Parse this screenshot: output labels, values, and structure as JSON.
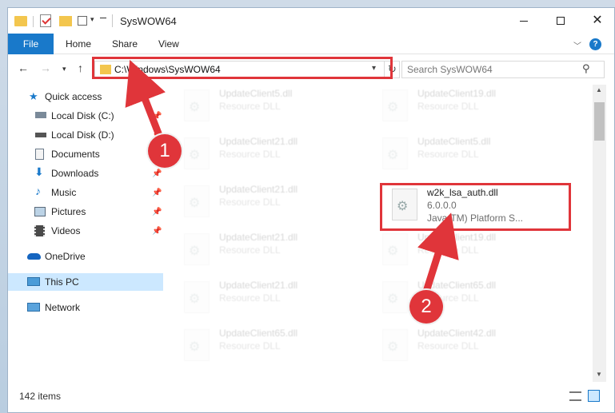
{
  "window": {
    "title": "SysWOW64",
    "controls": {
      "minimize": "",
      "maximize": "",
      "close": "✕"
    }
  },
  "ribbon": {
    "tabs": [
      "File",
      "Home",
      "Share",
      "View"
    ],
    "help": "?"
  },
  "navigation": {
    "address": "C:\\Windows\\SysWOW64",
    "search_placeholder": "Search SysWOW64"
  },
  "sidebar": {
    "items": [
      {
        "label": "Quick access",
        "icon": "star-icon",
        "pinned": false
      },
      {
        "label": "Local Disk (C:)",
        "icon": "drive-icon",
        "pinned": true
      },
      {
        "label": "Local Disk (D:)",
        "icon": "drive-icon",
        "pinned": true
      },
      {
        "label": "Documents",
        "icon": "documents-icon",
        "pinned": true
      },
      {
        "label": "Downloads",
        "icon": "downloads-icon",
        "pinned": true
      },
      {
        "label": "Music",
        "icon": "music-icon",
        "pinned": true
      },
      {
        "label": "Pictures",
        "icon": "pictures-icon",
        "pinned": true
      },
      {
        "label": "Videos",
        "icon": "videos-icon",
        "pinned": true
      },
      {
        "label": "OneDrive",
        "icon": "onedrive-icon",
        "pinned": false
      },
      {
        "label": "This PC",
        "icon": "pc-icon",
        "pinned": false,
        "selected": true
      },
      {
        "label": "Network",
        "icon": "network-icon",
        "pinned": false
      }
    ]
  },
  "files": [
    {
      "name": "UpdateClient5.dll",
      "line2": "Resource DLL",
      "line3": "",
      "faded": true
    },
    {
      "name": "UpdateClient19.dll",
      "line2": "Resource DLL",
      "line3": "",
      "faded": true
    },
    {
      "name": "UpdateClient21.dll",
      "line2": "Resource DLL",
      "line3": "",
      "faded": true
    },
    {
      "name": "UpdateClient5.dll",
      "line2": "Resource DLL",
      "line3": "",
      "faded": true
    },
    {
      "name": "UpdateClient21.dll",
      "line2": "Resource DLL",
      "line3": "",
      "faded": true
    },
    {
      "name": "w2k_lsa_auth.dll",
      "line2": "6.0.0.0",
      "line3": "Java(TM) Platform S...",
      "faded": false
    },
    {
      "name": "UpdateClient21.dll",
      "line2": "Resource DLL",
      "line3": "",
      "faded": true
    },
    {
      "name": "UpdateClient19.dll",
      "line2": "Resource DLL",
      "line3": "",
      "faded": true
    },
    {
      "name": "UpdateClient21.dll",
      "line2": "Resource DLL",
      "line3": "",
      "faded": true
    },
    {
      "name": "UpdateClient65.dll",
      "line2": "Resource DLL",
      "line3": "",
      "faded": true
    },
    {
      "name": "UpdateClient65.dll",
      "line2": "Resource DLL",
      "line3": "",
      "faded": true
    },
    {
      "name": "UpdateClient42.dll",
      "line2": "Resource DLL",
      "line3": "",
      "faded": true
    }
  ],
  "statusbar": {
    "count": "142 items"
  },
  "annotations": {
    "step1": "1",
    "step2": "2",
    "color": "#e0353a"
  },
  "colors": {
    "accent": "#1979ca",
    "selection": "#cce8ff",
    "folder": "#f3c64e"
  }
}
